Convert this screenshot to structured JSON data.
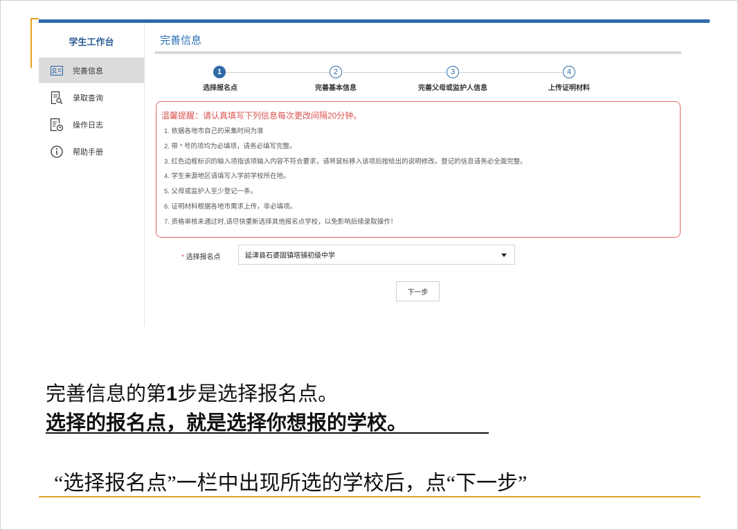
{
  "sidebar": {
    "title": "学生工作台",
    "items": [
      {
        "label": "完善信息",
        "icon": "id-card-icon",
        "active": true
      },
      {
        "label": "录取查询",
        "icon": "document-search-icon",
        "active": false
      },
      {
        "label": "操作日志",
        "icon": "log-clock-icon",
        "active": false
      },
      {
        "label": "帮助手册",
        "icon": "info-icon",
        "active": false
      }
    ]
  },
  "main": {
    "title": "完善信息",
    "steps": [
      {
        "num": "1",
        "label": "选择报名点",
        "state": "done"
      },
      {
        "num": "2",
        "label": "完善基本信息",
        "state": "todo"
      },
      {
        "num": "3",
        "label": "完善父母或监护人信息",
        "state": "todo"
      },
      {
        "num": "4",
        "label": "上传证明材料",
        "state": "todo"
      }
    ],
    "notice": {
      "heading": "温馨提醒：请认真填写下列信息每次更改间隔20分钟。",
      "items": [
        "1. 依据各地市自己的采集时间为准",
        "2. 带 * 号的项均为必填项，请务必填写完整。",
        "3. 红色边框标识的输入项指该项输入内容不符合要求，请将鼠标移入该项后按给出的说明修改。登记的信息请务必全面完整。",
        "4. 学生来源地区请填写入学前学校所在地。",
        "5. 父母或监护人至少登记一条。",
        "6. 证明材料根据各地市需求上传，非必填项。",
        "7. 资格审核未通过时,请尽快重新选择其他报名点学校，以免影响后续录取操作！"
      ]
    },
    "form": {
      "required_mark": "*",
      "select_label": "选择报名点",
      "select_value": "延津县石婆固镇塔铺初级中学"
    },
    "next_button": "下一步"
  },
  "captions": {
    "line1_pre": "完善信息的第",
    "line1_num": "1",
    "line1_post": "步是选择报名点。",
    "line2": "选择的报名点，就是选择你想报的学校。",
    "line3": "“选择报名点”一栏中出现所选的学校后，点“下一步”"
  },
  "colors": {
    "accent_blue": "#2e6aa6",
    "warning_red": "#d9534f",
    "gold": "#e3a21a"
  }
}
